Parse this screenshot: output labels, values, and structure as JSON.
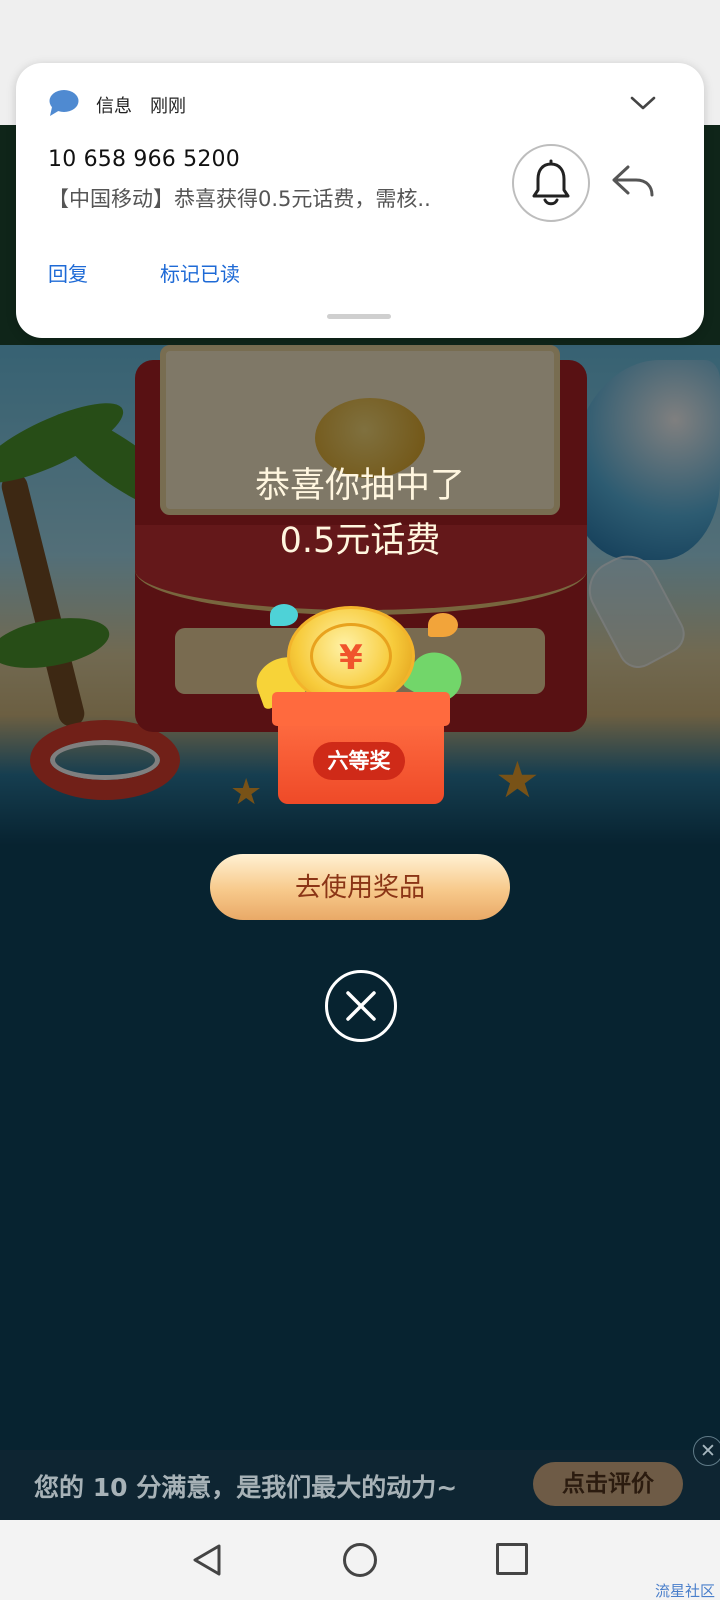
{
  "notification": {
    "app_name": "信息",
    "time": "刚刚",
    "sender": "10 658 966 5200",
    "body": "【中国移动】恭喜获得0.5元话费，需核..",
    "actions": {
      "reply": "回复",
      "mark_read": "标记已读"
    }
  },
  "prize": {
    "title": "恭喜你抽中了",
    "amount": "0.5元话费",
    "coin_symbol": "¥",
    "rank_badge": "六等奖",
    "use_button": "去使用奖品"
  },
  "rating_bar": {
    "text": "您的 10 分满意，是我们最大的动力~",
    "button": "点击评价",
    "close": "✕"
  },
  "watermark": "流星社区",
  "icons": {
    "app": "message-bubble-icon",
    "expand": "chevron-down-icon",
    "bell": "bell-icon",
    "reply": "reply-arrow-icon",
    "close": "close-circle-icon",
    "nav": [
      "back-triangle-icon",
      "home-circle-icon",
      "recent-square-icon"
    ]
  },
  "colors": {
    "accent_blue": "#1e6ad6",
    "ocean": "#0f4661",
    "button_text": "#8b3516",
    "badge_red": "#cf2a18"
  }
}
